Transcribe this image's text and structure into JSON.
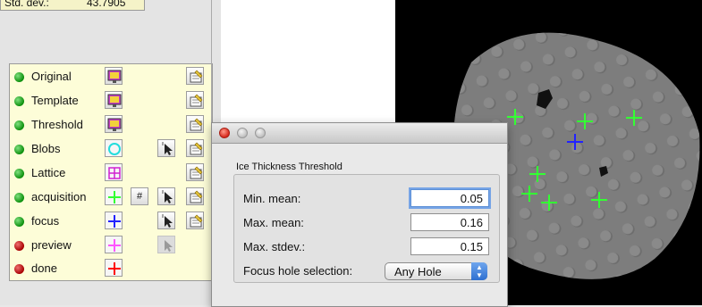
{
  "stats": {
    "label": "Std. dev.:",
    "value": "43.7905"
  },
  "layers": [
    {
      "name": "Original",
      "status": "green",
      "color_icon": "monitor-icon",
      "tool_icon": null,
      "has_hash": false,
      "has_settings": true
    },
    {
      "name": "Template",
      "status": "green",
      "color_icon": "monitor-icon",
      "tool_icon": null,
      "has_hash": false,
      "has_settings": true
    },
    {
      "name": "Threshold",
      "status": "green",
      "color_icon": "monitor-icon",
      "tool_icon": null,
      "has_hash": false,
      "has_settings": true
    },
    {
      "name": "Blobs",
      "status": "green",
      "color_icon": "cyan-circle-icon",
      "tool_icon": "cursor-icon",
      "has_hash": false,
      "has_settings": true
    },
    {
      "name": "Lattice",
      "status": "green",
      "color_icon": "lattice-icon",
      "tool_icon": null,
      "has_hash": false,
      "has_settings": true
    },
    {
      "name": "acquisition",
      "status": "green",
      "color_icon": "green-cross-icon",
      "tool_icon": "cursor-icon",
      "has_hash": true,
      "hash_label": "#",
      "has_settings": true
    },
    {
      "name": "focus",
      "status": "green",
      "color_icon": "blue-cross-icon",
      "tool_icon": "cursor-icon",
      "has_hash": false,
      "has_settings": true
    },
    {
      "name": "preview",
      "status": "red",
      "color_icon": "magenta-cross-icon",
      "tool_icon": "cursor-disabled-icon",
      "has_hash": false,
      "has_settings": false
    },
    {
      "name": "done",
      "status": "red",
      "color_icon": "red-cross-icon",
      "tool_icon": null,
      "has_hash": false,
      "has_settings": false
    }
  ],
  "dialog": {
    "group_title": "Ice Thickness Threshold",
    "min_mean_label": "Min. mean:",
    "min_mean_value": "0.05",
    "max_mean_label": "Max. mean:",
    "max_mean_value": "0.16",
    "max_stdev_label": "Max. stdev.:",
    "max_stdev_value": "0.15",
    "focus_label": "Focus hole selection:",
    "focus_value": "Any Hole"
  },
  "colors": {
    "acquisition": "#33ff33",
    "focus": "#2222ff",
    "preview": "#ff55ff",
    "done": "#ff0000",
    "blobs": "#22dddd"
  }
}
